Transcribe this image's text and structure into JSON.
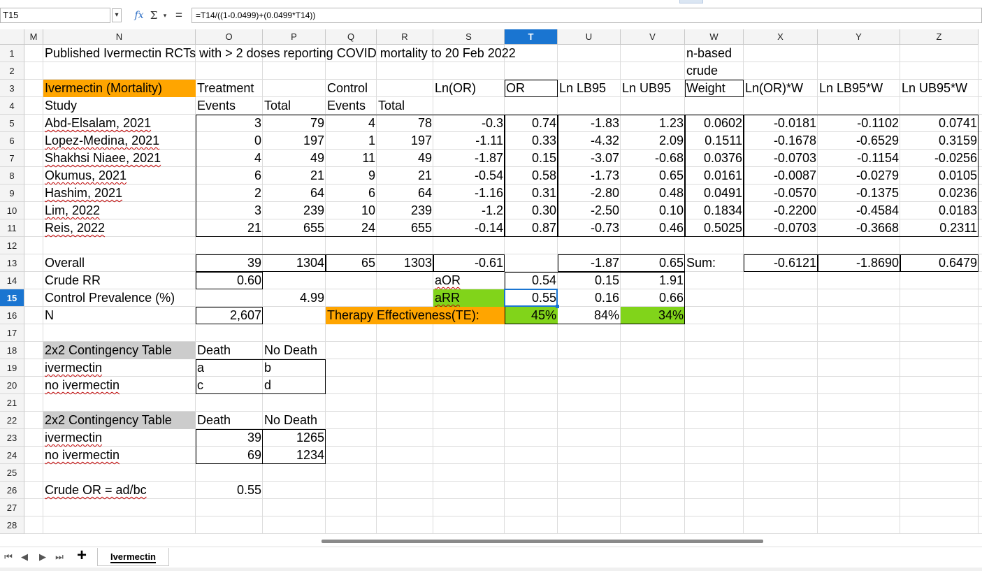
{
  "formula_bar": {
    "cell_ref": "T15",
    "fx_label": "fx",
    "sum_label": "Σ",
    "dropdown_glyph": "▾",
    "equals_label": "=",
    "formula": "=T14/((1-0.0499)+(0.0499*T14))"
  },
  "columns": [
    "M",
    "N",
    "O",
    "P",
    "Q",
    "R",
    "S",
    "T",
    "U",
    "V",
    "W",
    "X",
    "Y",
    "Z"
  ],
  "active_column": "T",
  "rows": [
    "1",
    "2",
    "3",
    "4",
    "5",
    "6",
    "7",
    "8",
    "9",
    "10",
    "11",
    "12",
    "13",
    "14",
    "15",
    "16",
    "17",
    "18",
    "19",
    "20",
    "21",
    "22",
    "23",
    "24",
    "25",
    "26",
    "27",
    "28"
  ],
  "active_row": "15",
  "sheet": {
    "title": "Published Ivermectin RCTs with > 2 doses reporting COVID mortality to 20 Feb 2022",
    "w1": "n-based",
    "w2": "crude",
    "header3": {
      "N": "Ivermectin (Mortality)",
      "O": "Treatment",
      "Q": "Control",
      "S": "Ln(OR)",
      "T": "OR",
      "U": "Ln LB95",
      "V": "Ln UB95",
      "W": "Weight",
      "X": "Ln(OR)*W",
      "Y": "Ln LB95*W",
      "Z": "Ln UB95*W"
    },
    "header4": {
      "N": "Study",
      "O": "Events",
      "P": "Total",
      "Q": "Events",
      "R": "Total"
    },
    "studies": [
      {
        "N": "Abd-Elsalam, 2021",
        "O": "3",
        "P": "79",
        "Q": "4",
        "R": "78",
        "S": "-0.3",
        "T": "0.74",
        "U": "-1.83",
        "V": "1.23",
        "W": "0.0602",
        "X": "-0.0181",
        "Y": "-0.1102",
        "Z": "0.0741"
      },
      {
        "N": "Lopez-Medina, 2021",
        "O": "0",
        "P": "197",
        "Q": "1",
        "R": "197",
        "S": "-1.11",
        "T": "0.33",
        "U": "-4.32",
        "V": "2.09",
        "W": "0.1511",
        "X": "-0.1678",
        "Y": "-0.6529",
        "Z": "0.3159"
      },
      {
        "N": "Shakhsi Niaee, 2021",
        "O": "4",
        "P": "49",
        "Q": "11",
        "R": "49",
        "S": "-1.87",
        "T": "0.15",
        "U": "-3.07",
        "V": "-0.68",
        "W": "0.0376",
        "X": "-0.0703",
        "Y": "-0.1154",
        "Z": "-0.0256"
      },
      {
        "N": "Okumus, 2021",
        "O": "6",
        "P": "21",
        "Q": "9",
        "R": "21",
        "S": "-0.54",
        "T": "0.58",
        "U": "-1.73",
        "V": "0.65",
        "W": "0.0161",
        "X": "-0.0087",
        "Y": "-0.0279",
        "Z": "0.0105"
      },
      {
        "N": "Hashim, 2021",
        "O": "2",
        "P": "64",
        "Q": "6",
        "R": "64",
        "S": "-1.16",
        "T": "0.31",
        "U": "-2.80",
        "V": "0.48",
        "W": "0.0491",
        "X": "-0.0570",
        "Y": "-0.1375",
        "Z": "0.0236"
      },
      {
        "N": "Lim, 2022",
        "O": "3",
        "P": "239",
        "Q": "10",
        "R": "239",
        "S": "-1.2",
        "T": "0.30",
        "U": "-2.50",
        "V": "0.10",
        "W": "0.1834",
        "X": "-0.2200",
        "Y": "-0.4584",
        "Z": "0.0183"
      },
      {
        "N": "Reis, 2022",
        "O": "21",
        "P": "655",
        "Q": "24",
        "R": "655",
        "S": "-0.14",
        "T": "0.87",
        "U": "-0.73",
        "V": "0.46",
        "W": "0.5025",
        "X": "-0.0703",
        "Y": "-0.3668",
        "Z": "0.2311"
      }
    ],
    "overall": {
      "N": "Overall",
      "O": "39",
      "P": "1304",
      "Q": "65",
      "R": "1303",
      "S": "-0.61",
      "U": "-1.87",
      "V": "0.65",
      "W": "Sum:",
      "X": "-0.6121",
      "Y": "-1.8690",
      "Z": "0.6479"
    },
    "crude_rr": {
      "N": "Crude RR",
      "O": "0.60",
      "S": "aOR",
      "T": "0.54",
      "U": "0.15",
      "V": "1.91"
    },
    "control_prev": {
      "N": "Control Prevalence (%)",
      "P": "4.99",
      "S": "aRR",
      "T": "0.55",
      "U": "0.16",
      "V": "0.66"
    },
    "n_row": {
      "N": "N",
      "O": "2,607",
      "Q": "Therapy Effectiveness(TE):",
      "T": "45%",
      "U": "84%",
      "V": "34%"
    },
    "table1": {
      "title": "2x2 Contingency Table",
      "death": "Death",
      "nodeath": "No Death",
      "row1": "ivermectin",
      "row2": "no ivermectin",
      "a": "a",
      "b": "b",
      "c": "c",
      "d": "d"
    },
    "table2": {
      "title": "2x2 Contingency Table",
      "death": "Death",
      "nodeath": "No Death",
      "row1": "ivermectin",
      "row2": "no ivermectin",
      "a": "39",
      "b": "1265",
      "c": "69",
      "d": "1234"
    },
    "crude_or": {
      "label": "Crude OR = ad/bc",
      "value": "0.55"
    }
  },
  "sheet_tabs": {
    "nav": [
      "⏮",
      "◀",
      "▶",
      "⏭"
    ],
    "add_label": "+",
    "active": "Ivermectin"
  },
  "colors": {
    "orange": "#ffa500",
    "green": "#81d41a",
    "grey": "#cccccc",
    "selection": "#1a75d1"
  }
}
